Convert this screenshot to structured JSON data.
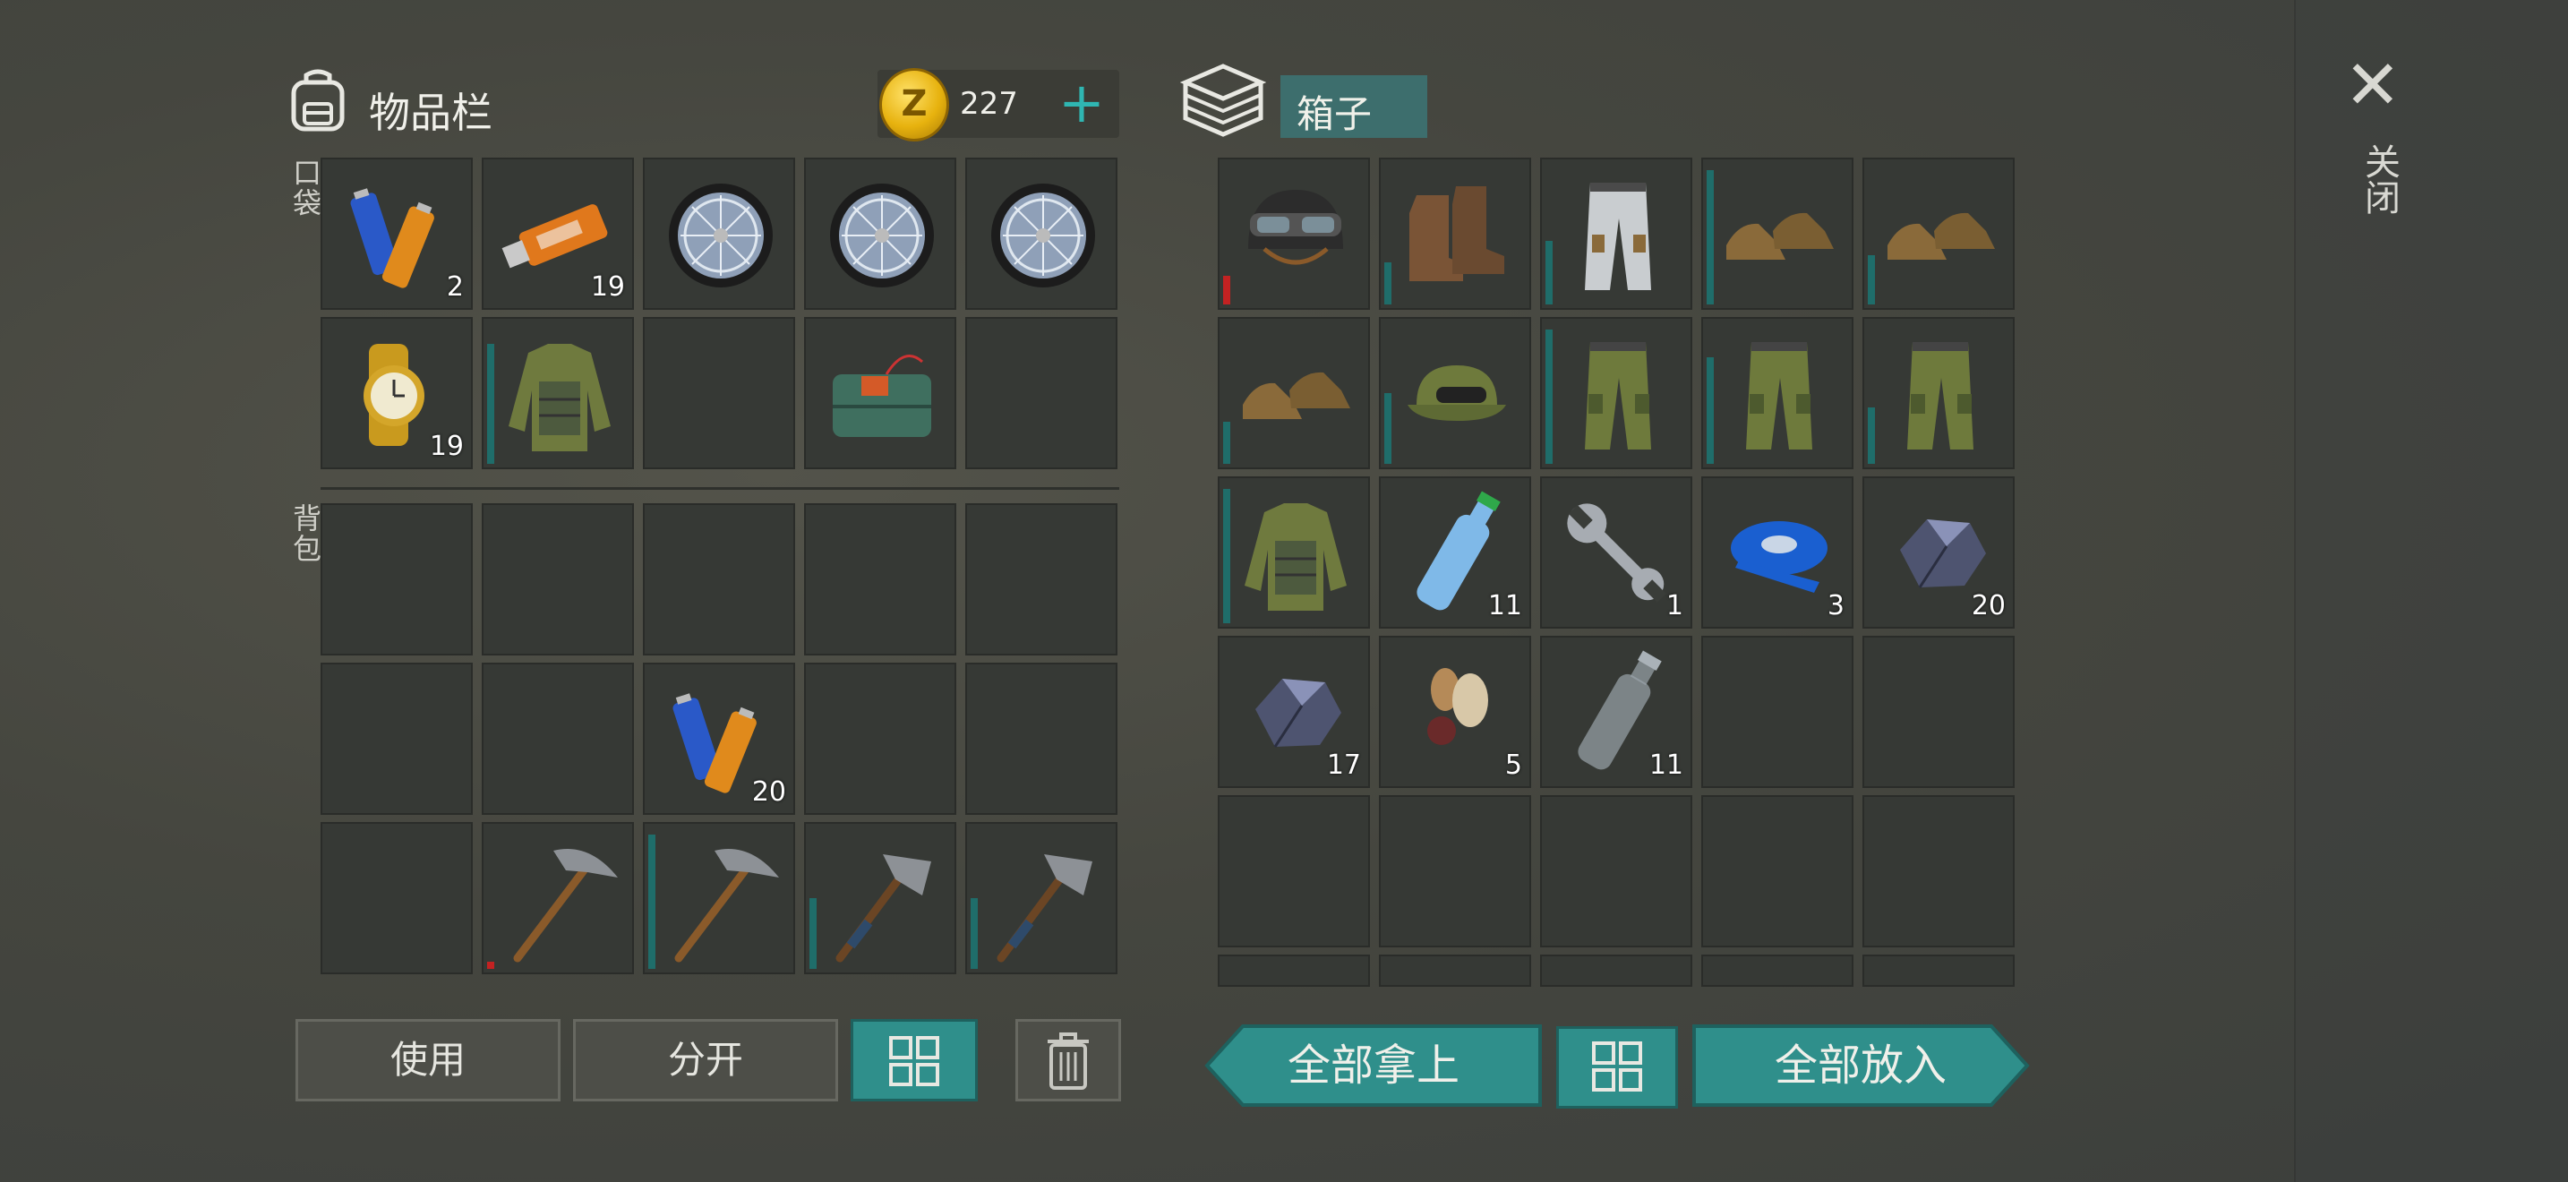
{
  "inventory": {
    "title": "物品栏",
    "coins": "227",
    "plus": "+",
    "pocket_label": "口袋",
    "backpack_label": "背包",
    "pocket": [
      {
        "item": "batteries",
        "count": "2"
      },
      {
        "item": "usb-stick",
        "count": "19"
      },
      {
        "item": "wheel",
        "count": ""
      },
      {
        "item": "wheel",
        "count": ""
      },
      {
        "item": "wheel",
        "count": ""
      },
      {
        "item": "watch",
        "count": "19"
      },
      {
        "item": "camo-jacket",
        "count": "",
        "durability": 0.85
      },
      {
        "item": "empty",
        "count": ""
      },
      {
        "item": "c4-charge",
        "count": ""
      },
      {
        "item": "empty",
        "count": ""
      }
    ],
    "backpack": [
      {
        "item": "empty",
        "count": ""
      },
      {
        "item": "empty",
        "count": ""
      },
      {
        "item": "empty",
        "count": ""
      },
      {
        "item": "empty",
        "count": ""
      },
      {
        "item": "empty",
        "count": ""
      },
      {
        "item": "empty",
        "count": ""
      },
      {
        "item": "empty",
        "count": ""
      },
      {
        "item": "batteries",
        "count": "20"
      },
      {
        "item": "empty",
        "count": ""
      },
      {
        "item": "empty",
        "count": ""
      },
      {
        "item": "empty",
        "count": ""
      },
      {
        "item": "pickaxe",
        "count": "",
        "durability": 0.05,
        "dur_color": "red"
      },
      {
        "item": "pickaxe",
        "count": "",
        "durability": 0.95
      },
      {
        "item": "hammer",
        "count": "",
        "durability": 0.5
      },
      {
        "item": "hammer",
        "count": "",
        "durability": 0.5
      }
    ],
    "buttons": {
      "use": "使用",
      "split": "分开"
    }
  },
  "box": {
    "title": "箱子",
    "items": [
      {
        "item": "helmet",
        "count": "",
        "durability": 0.2,
        "dur_color": "red"
      },
      {
        "item": "boots-brown",
        "count": "",
        "durability": 0.3
      },
      {
        "item": "pants-white",
        "count": "",
        "durability": 0.45
      },
      {
        "item": "boots-tan",
        "count": "",
        "durability": 0.95
      },
      {
        "item": "boots-tan",
        "count": "",
        "durability": 0.35
      },
      {
        "item": "boots-tan",
        "count": "",
        "durability": 0.3
      },
      {
        "item": "camo-cap",
        "count": "",
        "durability": 0.5
      },
      {
        "item": "camo-pants",
        "count": "",
        "durability": 0.95
      },
      {
        "item": "camo-pants",
        "count": "",
        "durability": 0.75
      },
      {
        "item": "camo-pants",
        "count": "",
        "durability": 0.4
      },
      {
        "item": "camo-jacket",
        "count": "",
        "durability": 0.95
      },
      {
        "item": "water-bottle",
        "count": "11"
      },
      {
        "item": "wrench",
        "count": "1"
      },
      {
        "item": "tape",
        "count": "3"
      },
      {
        "item": "ore",
        "count": "20"
      },
      {
        "item": "ore",
        "count": "17"
      },
      {
        "item": "nuts",
        "count": "5"
      },
      {
        "item": "empty-bottle",
        "count": "11"
      },
      {
        "item": "empty",
        "count": ""
      },
      {
        "item": "empty",
        "count": ""
      }
    ],
    "buttons": {
      "take_all": "全部拿上",
      "put_all": "全部放入"
    }
  },
  "close_label": "关闭",
  "colors": {
    "accent": "#2f8f8b",
    "slot": "#363935",
    "durability": "#1f6d6a",
    "durability_low": "#c32222"
  }
}
